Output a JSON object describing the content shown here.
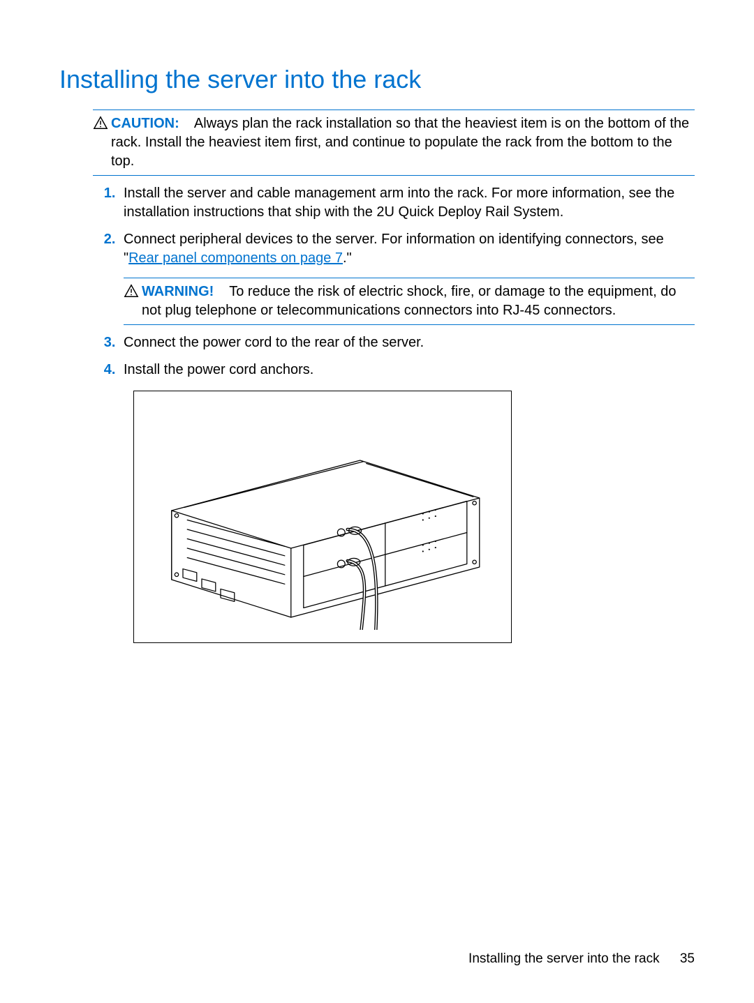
{
  "heading": "Installing the server into the rack",
  "caution": {
    "label": "CAUTION:",
    "text": "Always plan the rack installation so that the heaviest item is on the bottom of the rack. Install the heaviest item first, and continue to populate the rack from the bottom to the top."
  },
  "steps": {
    "s1": "Install the server and cable management arm into the rack. For more information, see the installation instructions that ship with the 2U Quick Deploy Rail System.",
    "s2_pre": "Connect peripheral devices to the server. For information on identifying connectors, see \"",
    "s2_link": "Rear panel components on page 7",
    "s2_post": ".\"",
    "s3": "Connect the power cord to the rear of the server.",
    "s4": "Install the power cord anchors."
  },
  "warning": {
    "label": "WARNING!",
    "text": "To reduce the risk of electric shock, fire, or damage to the equipment, do not plug telephone or telecommunications connectors into RJ-45 connectors."
  },
  "footer": {
    "title": "Installing the server into the rack",
    "page": "35"
  }
}
